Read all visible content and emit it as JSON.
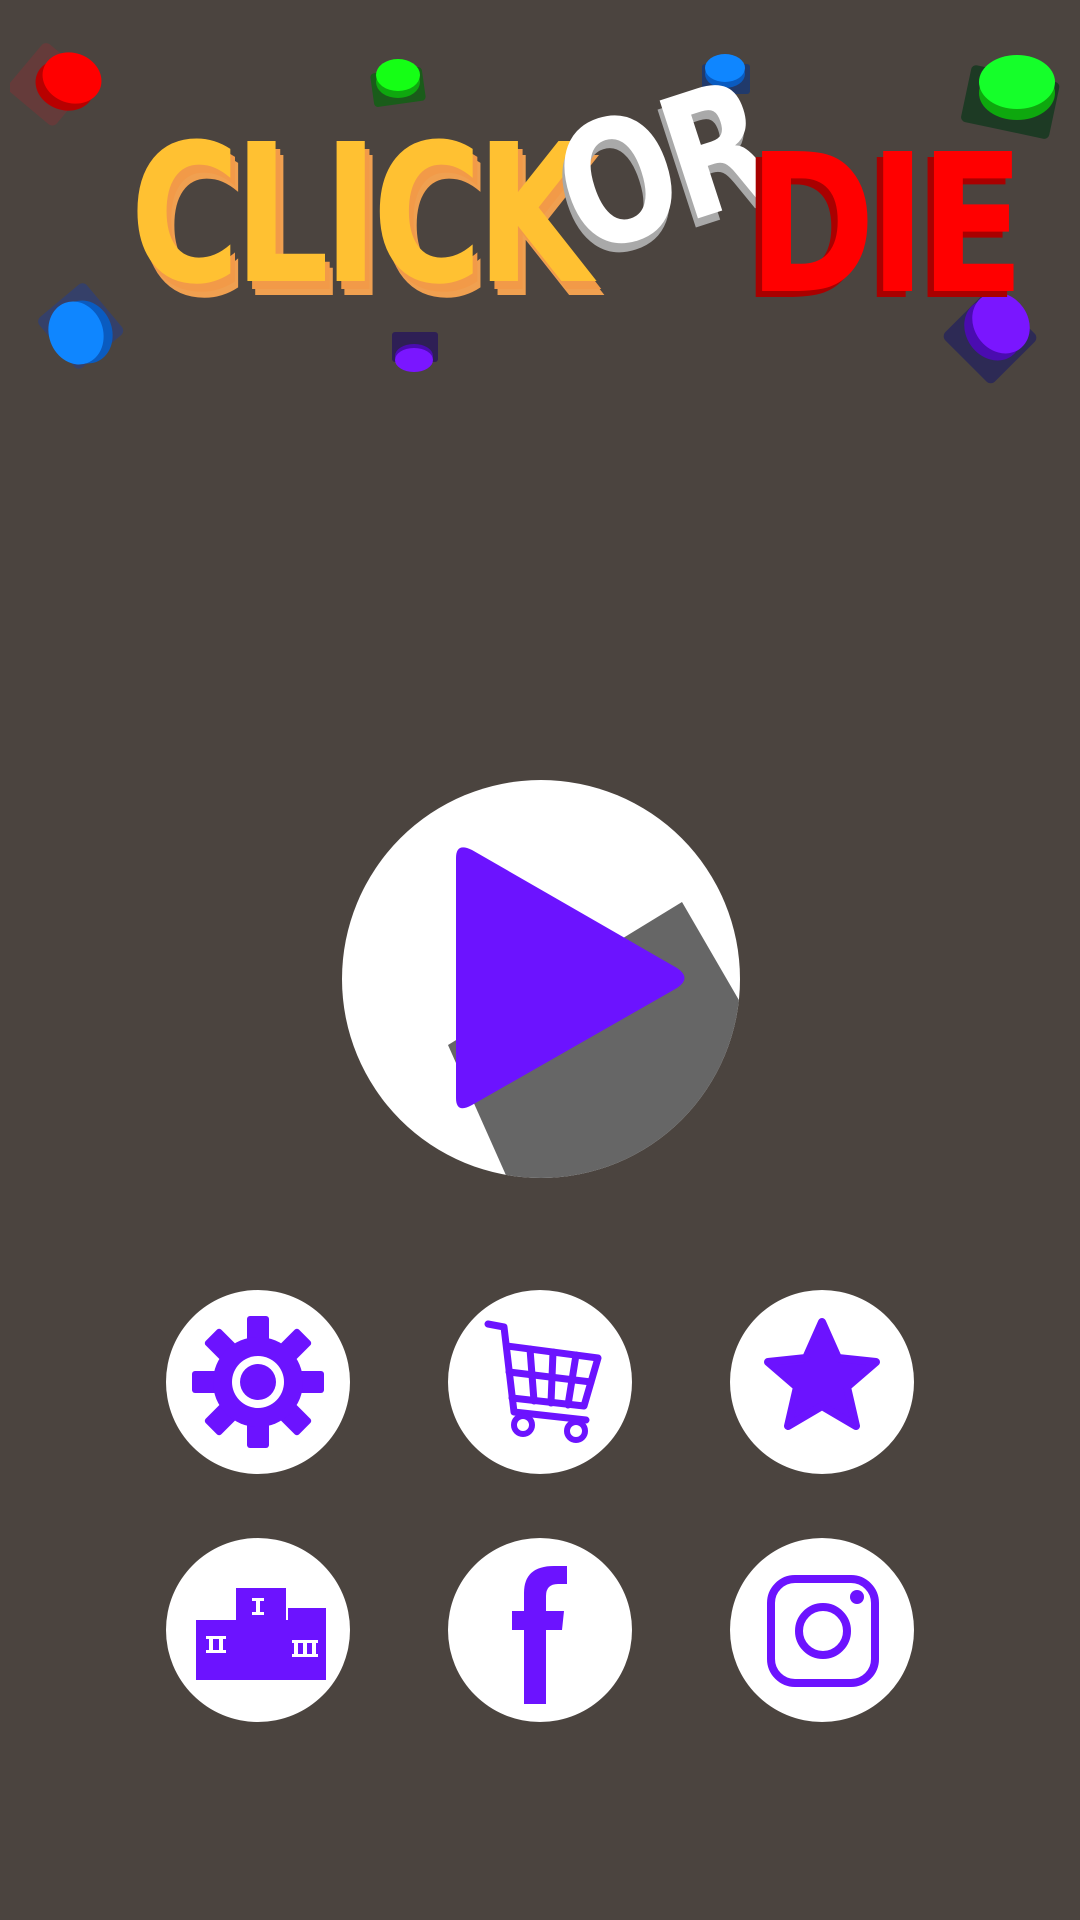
{
  "title": {
    "word1": "CLICK",
    "word2": "OR",
    "word3": "DIE"
  },
  "colors": {
    "background": "#4b443f",
    "accent_purple": "#6c13ff",
    "title_yellow": "#ffc132",
    "title_red": "#ff0000",
    "title_white": "#ffffff",
    "button_white": "#ffffff"
  },
  "icons": {
    "play": "play-icon",
    "settings": "gear-icon",
    "shop": "cart-icon",
    "rate": "star-icon",
    "leaderboard": "podium-icon",
    "facebook": "facebook-icon",
    "instagram": "instagram-icon"
  },
  "podium": {
    "first": "I",
    "second": "II",
    "third": "III"
  },
  "decorative_buttons": [
    "red",
    "green",
    "blue",
    "green",
    "blue",
    "purple",
    "purple"
  ]
}
